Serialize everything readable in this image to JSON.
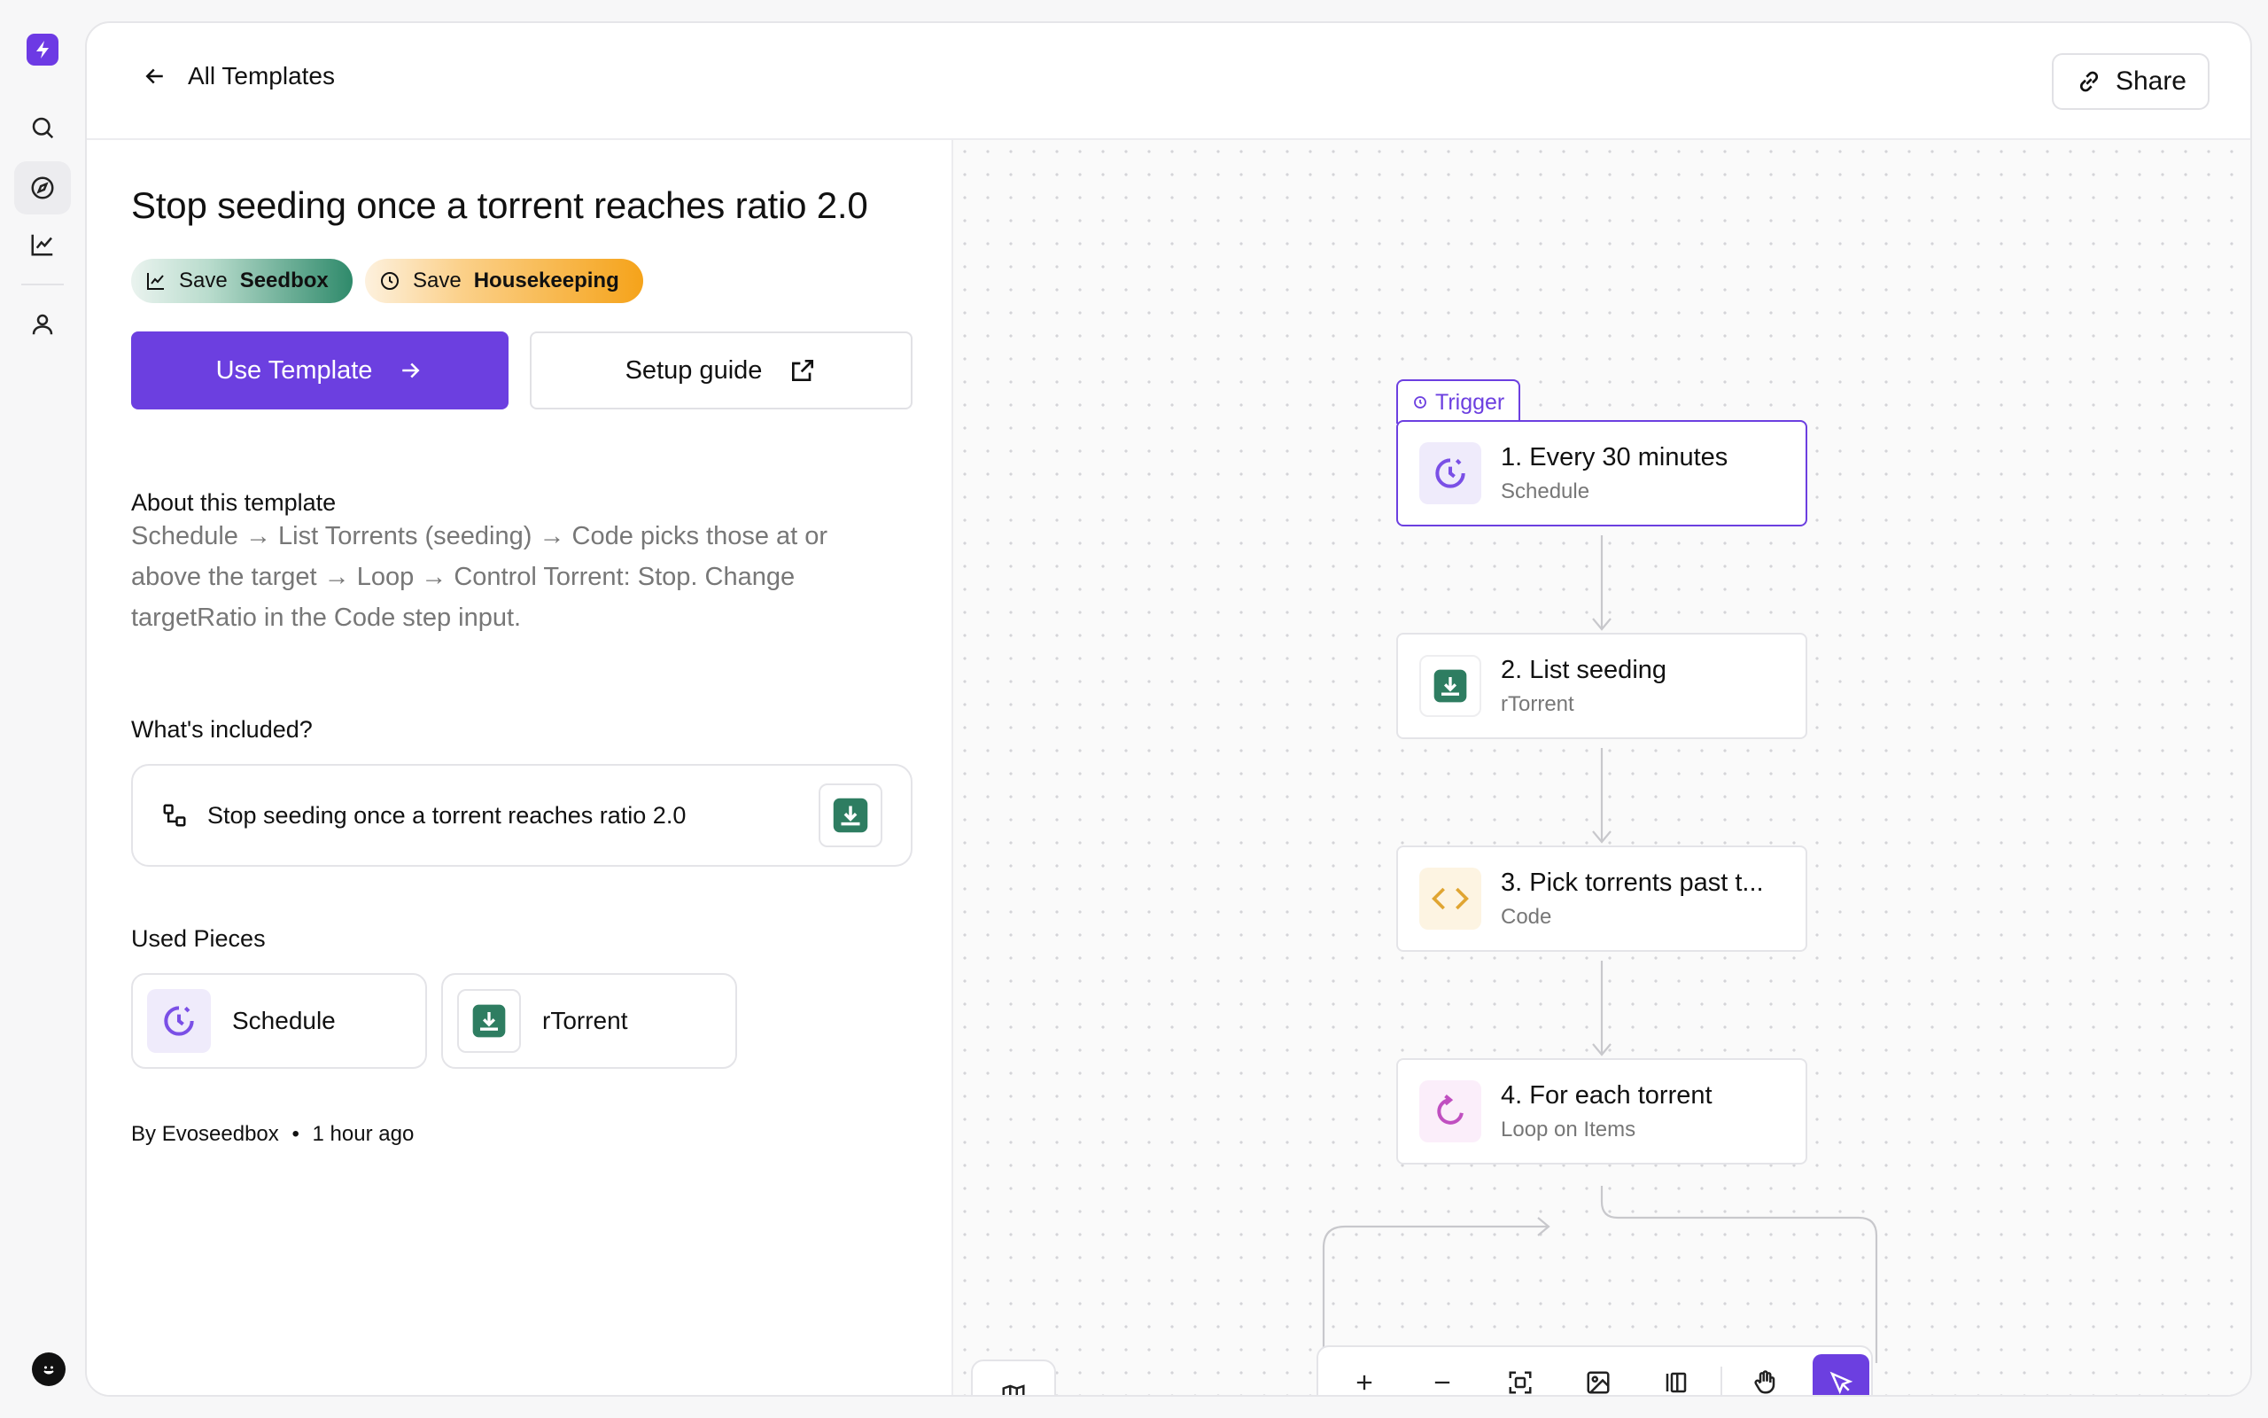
{
  "topbar": {
    "back_label": "All Templates",
    "share_label": "Share"
  },
  "template": {
    "title": "Stop seeding once a torrent reaches ratio 2.0",
    "tags": [
      {
        "prefix": "Save",
        "name": "Seedbox",
        "icon": "chart-line-icon"
      },
      {
        "prefix": "Save",
        "name": "Housekeeping",
        "icon": "clock-icon"
      }
    ],
    "use_button": "Use Template",
    "guide_button": "Setup guide",
    "about_heading": "About this template",
    "description": "Schedule → List Torrents (seeding) → Code picks those at or above the target → Loop → Control Torrent: Stop. Change targetRatio in the Code step input.",
    "included_heading": "What's included?",
    "included_item": "Stop seeding once a torrent reaches ratio 2.0",
    "pieces_heading": "Used Pieces",
    "pieces": [
      {
        "name": "Schedule"
      },
      {
        "name": "rTorrent"
      }
    ],
    "author_prefix": "By",
    "author": "Evoseedbox",
    "time_ago": "1 hour ago"
  },
  "flow": {
    "trigger_label": "Trigger",
    "nodes": [
      {
        "title": "1. Every 30 minutes",
        "sub": "Schedule"
      },
      {
        "title": "2. List seeding",
        "sub": "rTorrent"
      },
      {
        "title": "3. Pick torrents past t...",
        "sub": "Code"
      },
      {
        "title": "4. For each torrent",
        "sub": "Loop on Items"
      }
    ]
  },
  "colors": {
    "accent": "#6c3fe0",
    "rtorrent": "#2e7d61",
    "code": "#e0a532",
    "loop": "#c04fc0"
  }
}
